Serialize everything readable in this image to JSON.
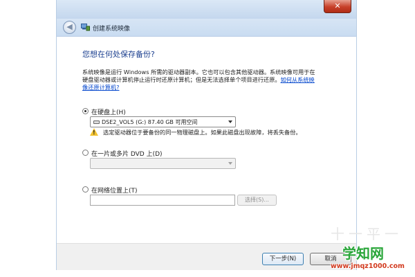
{
  "window": {
    "title": "创建系统映像",
    "close_glyph": "✕",
    "back_glyph": "◀"
  },
  "main": {
    "heading": "您想在何处保存备份?",
    "description": "系统映像是运行 Windows 所需的驱动器副本。它也可以包含其他驱动器。系统映像可用于在硬盘驱动器或计算机停止运行时还原计算机；但是无法选择单个项目进行还原。",
    "help_link": "如何从系统映像还原计算机?"
  },
  "options": {
    "hard_disk": {
      "label": "在硬盘上(H)",
      "selected": true,
      "disk_value": "DSE2_VOL5 (G:)  87.40 GB 可用空间",
      "warning": "选定驱动器位于要备份的同一物理磁盘上。如果此磁盘出现故障，将丢失备份。"
    },
    "dvd": {
      "label": "在一片或多片 DVD 上(D)",
      "selected": false,
      "value": ""
    },
    "network": {
      "label": "在网络位置上(T)",
      "selected": false,
      "value": "",
      "browse_label": "选择(S)..."
    }
  },
  "footer": {
    "next_label": "下一步(N)",
    "cancel_label": "取消"
  },
  "watermark": {
    "faint": "十一平一",
    "logo": "学知网",
    "url": "www.jmqz1000.com"
  },
  "colors": {
    "heading": "#1b3f8f",
    "link": "#0044cc",
    "close_button": "#c7402a",
    "warning": "#f2c230",
    "watermark_logo": "#2aa63a",
    "watermark_url": "#d23a1e"
  },
  "icons": {
    "back": "back-arrow-icon",
    "app": "system-image-icon",
    "warning": "warning-icon",
    "disk": "disk-drive-icon",
    "dropdown": "chevron-down-icon"
  }
}
